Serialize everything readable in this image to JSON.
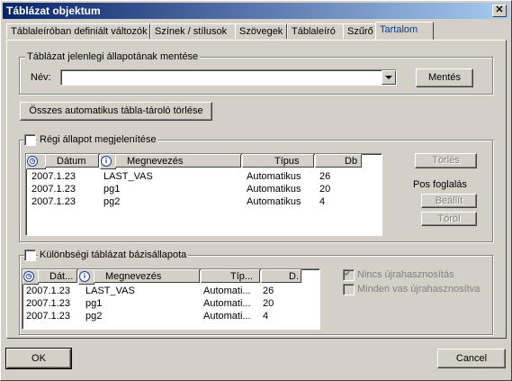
{
  "window": {
    "title": "Táblázat objektum",
    "close_glyph": "✕"
  },
  "tabs": [
    {
      "label": "Táblaleíróban definiált változók"
    },
    {
      "label": "Színek / stílusok"
    },
    {
      "label": "Szövegek"
    },
    {
      "label": "Táblaleíró"
    },
    {
      "label": "Szűrő"
    },
    {
      "label": "Tartalom"
    }
  ],
  "active_tab": "Tartalom",
  "save_group": {
    "legend": "Táblázat jelenlegi állapotának mentése",
    "name_label": "Név:",
    "name_value": "",
    "save_button": "Mentés"
  },
  "delete_all_button": "Összes automatikus tábla-tároló törlése",
  "old_state": {
    "checkbox_label": "Régi állapot megjelenítése",
    "checked": false,
    "columns": [
      "Dátum",
      "Megnevezés",
      "Típus",
      "Db"
    ],
    "rows": [
      [
        "2007.1.23",
        "LAST_VAS",
        "Automatikus",
        "26"
      ],
      [
        "2007.1.23",
        "pg1",
        "Automatikus",
        "20"
      ],
      [
        "2007.1.23",
        "pg2",
        "Automatikus",
        "4"
      ]
    ],
    "delete_button": "Törlés",
    "pos_label": "Pos foglalás",
    "set_button": "Beállít",
    "clear_button": "Töröl"
  },
  "diff_state": {
    "checkbox_label": "Különbségi táblázat bázisállapota",
    "checked": false,
    "columns": [
      "Dát...",
      "Megnevezés",
      "Típ...",
      "D."
    ],
    "rows": [
      [
        "2007.1.23",
        "LAST_VAS",
        "Automati...",
        "26"
      ],
      [
        "2007.1.23",
        "pg1",
        "Automati...",
        "20"
      ],
      [
        "2007.1.23",
        "pg2",
        "Automati...",
        "4"
      ]
    ],
    "option1": "Nincs újrahasznosítás",
    "option1_checked": true,
    "option2": "Minden vas újrahasznosítva",
    "option2_checked": false
  },
  "ok_button": "OK",
  "cancel_button": "Cancel",
  "icons": {
    "clock": "clock-icon",
    "info": "info-icon"
  }
}
